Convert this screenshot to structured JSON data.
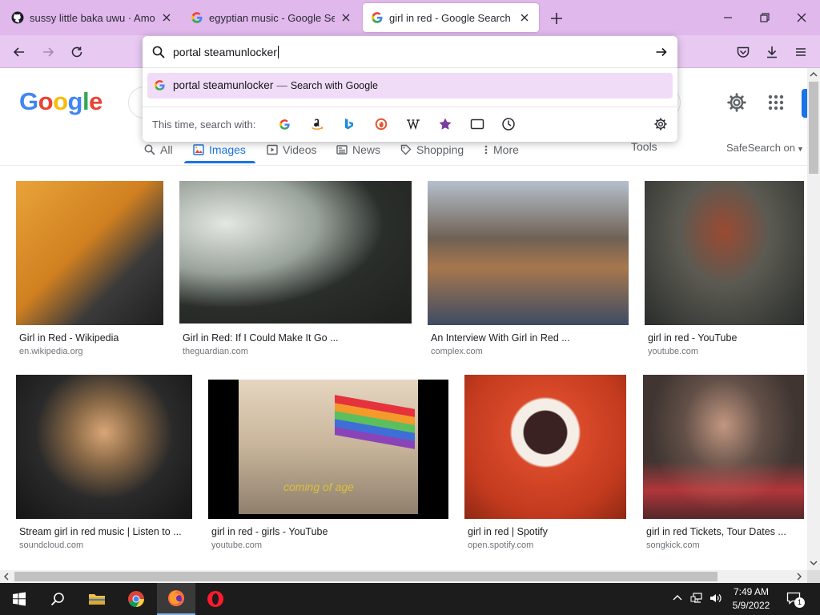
{
  "browser": {
    "tabs": [
      {
        "title": "sussy little baka uwu · Amog-O"
      },
      {
        "title": "egyptian music - Google Search"
      },
      {
        "title": "girl in red - Google Search"
      }
    ]
  },
  "urlbar": {
    "value": "portal steamunlocker",
    "suggestion": {
      "text": "portal steamunlocker",
      "separator": "—",
      "action": "Search with Google"
    },
    "search_with_label": "This time, search with:"
  },
  "google": {
    "logo": [
      "G",
      "o",
      "o",
      "g",
      "l",
      "e"
    ],
    "logo_colors": [
      "#4285f4",
      "#ea4335",
      "#fbbc05",
      "#4285f4",
      "#34a853",
      "#ea4335"
    ],
    "tabs": [
      {
        "label": "All"
      },
      {
        "label": "Images"
      },
      {
        "label": "Videos"
      },
      {
        "label": "News"
      },
      {
        "label": "Shopping"
      },
      {
        "label": "More"
      }
    ],
    "tools_label": "Tools",
    "safesearch_label": "SafeSearch on"
  },
  "results": [
    {
      "title": "Girl in Red - Wikipedia",
      "source": "en.wikipedia.org"
    },
    {
      "title": "Girl in Red: If I Could Make It Go ...",
      "source": "theguardian.com"
    },
    {
      "title": "An Interview With Girl in Red ...",
      "source": "complex.com"
    },
    {
      "title": "girl in red - YouTube",
      "source": "youtube.com"
    },
    {
      "title": "Stream girl in red music | Listen to ...",
      "source": "soundcloud.com"
    },
    {
      "title": "girl in red - girls - YouTube",
      "source": "youtube.com",
      "overlay_text": "coming of age"
    },
    {
      "title": "girl in red | Spotify",
      "source": "open.spotify.com"
    },
    {
      "title": "girl in red Tickets, Tour Dates ...",
      "source": "songkick.com"
    }
  ],
  "taskbar": {
    "time": "7:49 AM",
    "date": "5/9/2022",
    "notification_count": "1"
  },
  "colors": {
    "tabstrip": "#e0b8ec",
    "toolbar": "#e8c9f2",
    "suggestion_highlight": "#f0dcf6",
    "google_blue": "#1a73e8"
  }
}
